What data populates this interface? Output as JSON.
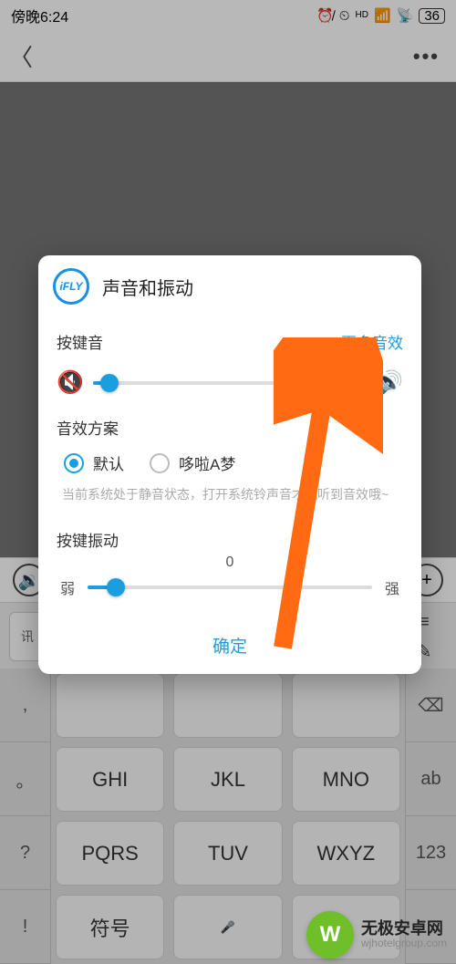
{
  "status": {
    "time": "傍晚6:24",
    "battery": "36"
  },
  "toolbar_icons": {
    "sound": "🔉",
    "add": "+"
  },
  "keyboard": {
    "left_col": [
      ",",
      "。",
      "?",
      "!"
    ],
    "main": [
      [
        "",
        "",
        ""
      ],
      [
        "GHI",
        "JKL",
        "MNO"
      ],
      [
        "PQRS",
        "TUV",
        "WXYZ"
      ],
      [
        "符号",
        "␣",
        ""
      ]
    ],
    "right_col": [
      "⌫",
      "ab",
      "123",
      ""
    ]
  },
  "modal": {
    "logo": "iFLY",
    "title": "声音和振动",
    "key_sound": {
      "label": "按键音",
      "more": "更多音效",
      "value_pct": 6
    },
    "scheme": {
      "label": "音效方案",
      "options": [
        {
          "label": "默认",
          "checked": true
        },
        {
          "label": "哆啦A梦",
          "checked": false
        }
      ],
      "hint": "当前系统处于静音状态，打开系统铃声音才能听到音效哦~"
    },
    "vibration": {
      "label": "按键振动",
      "scale": "0",
      "min": "弱",
      "max": "强",
      "value_pct": 10
    },
    "confirm": "确定"
  },
  "watermark": {
    "logo": "W",
    "title": "无极安卓网",
    "url": "wjhotelgroup.com"
  }
}
